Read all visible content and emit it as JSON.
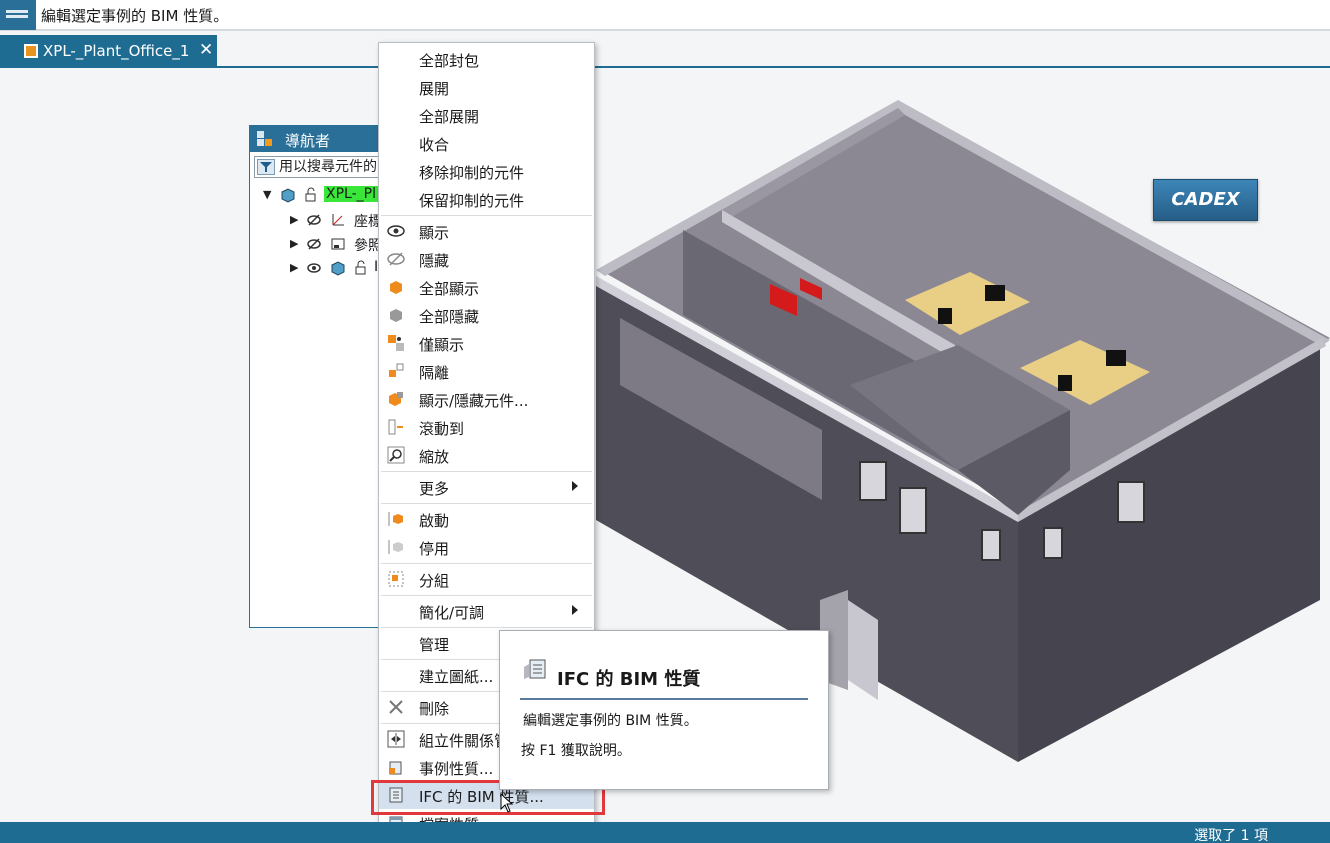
{
  "topbar": {
    "message": "編輯選定事例的 BIM 性質。"
  },
  "tabs": [
    {
      "label": "XPL-_Plant_Office_1"
    }
  ],
  "viewport": {
    "logo_text": "CADEX"
  },
  "navigator": {
    "title": "導航者",
    "search_placeholder": "用以搜尋元件的",
    "tree": [
      {
        "label": "XPL-_Pl",
        "expanded": true
      },
      {
        "label": "座標"
      },
      {
        "label": "參照"
      },
      {
        "label": "I"
      }
    ]
  },
  "context_menu": {
    "items": [
      {
        "label": "全部封包"
      },
      {
        "label": "展開"
      },
      {
        "label": "全部展開"
      },
      {
        "label": "收合"
      },
      {
        "label": "移除抑制的元件"
      },
      {
        "label": "保留抑制的元件"
      },
      {
        "label": "顯示",
        "icon": "eye-icon"
      },
      {
        "label": "隱藏",
        "icon": "eye-hidden-icon"
      },
      {
        "label": "全部顯示",
        "icon": "show-all-icon"
      },
      {
        "label": "全部隱藏",
        "icon": "hide-all-icon"
      },
      {
        "label": "僅顯示",
        "icon": "show-only-icon"
      },
      {
        "label": "隔離",
        "icon": "isolate-icon"
      },
      {
        "label": "顯示/隱藏元件...",
        "icon": "show-hide-icon"
      },
      {
        "label": "滾動到",
        "icon": "scroll-to-icon"
      },
      {
        "label": "縮放",
        "icon": "zoom-icon"
      },
      {
        "label": "更多",
        "submenu": true
      },
      {
        "label": "啟動",
        "icon": "activate-icon"
      },
      {
        "label": "停用",
        "icon": "deactivate-icon"
      },
      {
        "label": "分組",
        "icon": "group-icon"
      },
      {
        "label": "簡化/可調",
        "submenu": true
      },
      {
        "label": "管理"
      },
      {
        "label": "建立圖紙..."
      },
      {
        "label": "刪除",
        "icon": "delete-icon"
      },
      {
        "label": "組立件關係管",
        "icon": "relations-icon"
      },
      {
        "label": "事例性質...",
        "icon": "instance-properties-icon"
      },
      {
        "label": "IFC 的 BIM 性質...",
        "icon": "bim-properties-icon",
        "highlighted": true
      },
      {
        "label": "檔案性質...",
        "icon": "file-properties-icon"
      }
    ]
  },
  "tooltip": {
    "title": "IFC 的 BIM 性質",
    "description": "編輯選定事例的 BIM 性質。",
    "help": "按 F1 獲取說明。"
  },
  "status": {
    "selection": "選取了 1 項"
  },
  "colors": {
    "accent": "#1f6c93",
    "highlight_box": "#e0383d",
    "menu_hover": "#d4e0ee"
  }
}
